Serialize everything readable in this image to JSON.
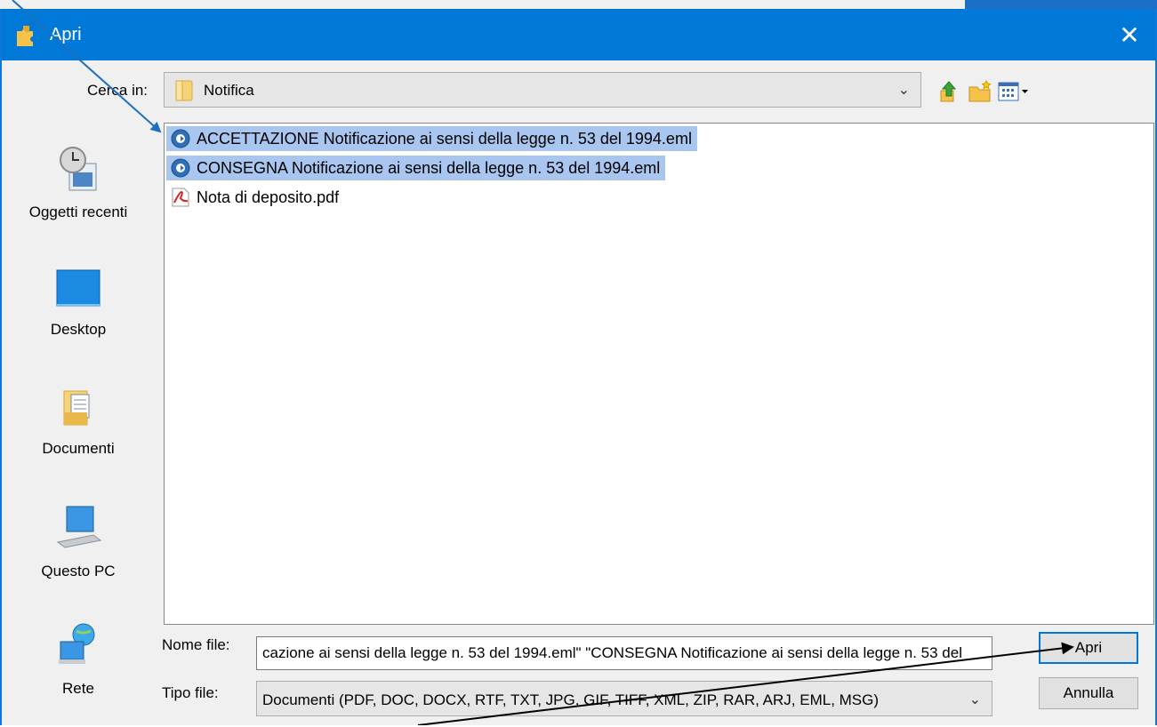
{
  "window": {
    "title": "Apri",
    "close_glyph": "✕"
  },
  "look_in": {
    "label": "Cerca in:",
    "value": "Notifica"
  },
  "toolbar": {
    "icons": [
      "up-folder-icon",
      "new-folder-icon",
      "view-menu-icon"
    ]
  },
  "places": [
    {
      "label": "Oggetti recenti",
      "icon": "recent-items-icon"
    },
    {
      "label": "Desktop",
      "icon": "desktop-icon"
    },
    {
      "label": "Documenti",
      "icon": "documents-icon"
    },
    {
      "label": "Questo PC",
      "icon": "computer-icon"
    },
    {
      "label": "Rete",
      "icon": "network-icon"
    }
  ],
  "files": [
    {
      "name": "ACCETTAZIONE Notificazione ai sensi della legge n. 53 del 1994.eml",
      "icon": "eml-icon",
      "selected": true
    },
    {
      "name": "CONSEGNA Notificazione ai sensi della legge n. 53 del 1994.eml",
      "icon": "eml-icon",
      "selected": true
    },
    {
      "name": "Nota di deposito.pdf",
      "icon": "pdf-icon",
      "selected": false
    }
  ],
  "file_name": {
    "label": "Nome file:",
    "value": "cazione ai sensi della legge n. 53 del 1994.eml\" \"CONSEGNA Notificazione ai sensi della legge n. 53 del"
  },
  "file_type": {
    "label": "Tipo file:",
    "value": "Documenti (PDF, DOC, DOCX, RTF, TXT, JPG, GIF, TIFF, XML, ZIP, RAR, ARJ, EML, MSG)"
  },
  "buttons": {
    "open": "Apri",
    "cancel": "Annulla"
  },
  "colors": {
    "title_bar": "#0078d7",
    "selection": "#a8c6f0",
    "arrow_blue": "#1f6fbf",
    "arrow_black": "#000000"
  }
}
